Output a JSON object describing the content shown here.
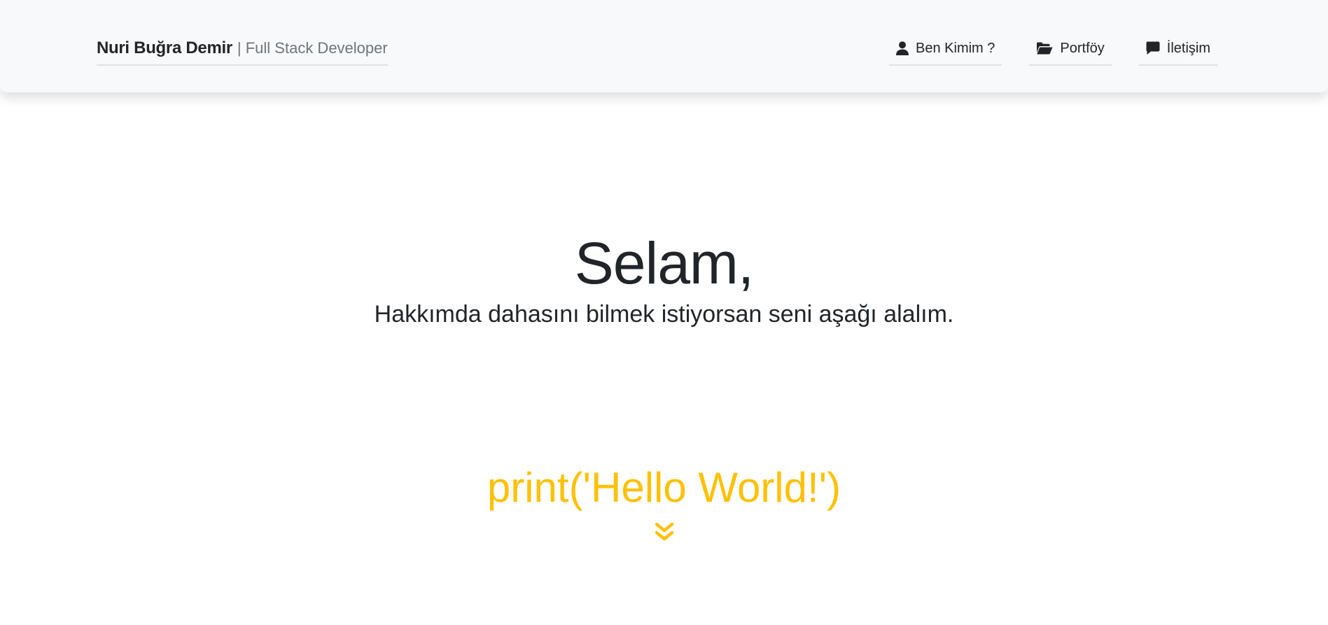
{
  "navbar": {
    "brand_name": "Nuri Buğra Demir",
    "brand_tagline": "| Full Stack Developer",
    "links": [
      {
        "label": "Ben Kimim ?",
        "icon": "user-icon"
      },
      {
        "label": "Portföy",
        "icon": "folder-open-icon"
      },
      {
        "label": "İletişim",
        "icon": "comment-icon"
      }
    ]
  },
  "hero": {
    "title": "Selam,",
    "subtitle": "Hakkımda dahasını bilmek istiyorsan seni aşağı alalım.",
    "code_line": "print('Hello World!')",
    "scroll_icon": "chevron-double-down-icon"
  },
  "colors": {
    "navbar_bg": "#f8f9fa",
    "text": "#212529",
    "muted": "#6c757d",
    "accent": "#ffc107"
  }
}
